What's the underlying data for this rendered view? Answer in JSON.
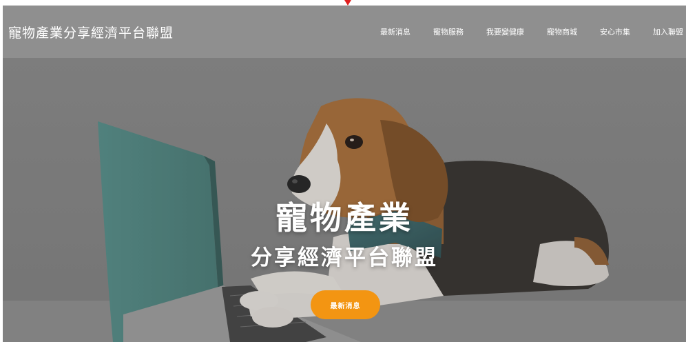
{
  "header": {
    "brand": "寵物產業分享經濟平台聯盟",
    "nav": [
      {
        "label": "最新消息"
      },
      {
        "label": "寵物服務"
      },
      {
        "label": "我要變健康"
      },
      {
        "label": "寵物商城"
      },
      {
        "label": "安心市集"
      },
      {
        "label": "加入聯盟"
      }
    ]
  },
  "hero": {
    "title": "寵物產業",
    "subtitle": "分享經濟平台聯盟",
    "button_label": "最新消息",
    "accent_color": "#f39512"
  }
}
